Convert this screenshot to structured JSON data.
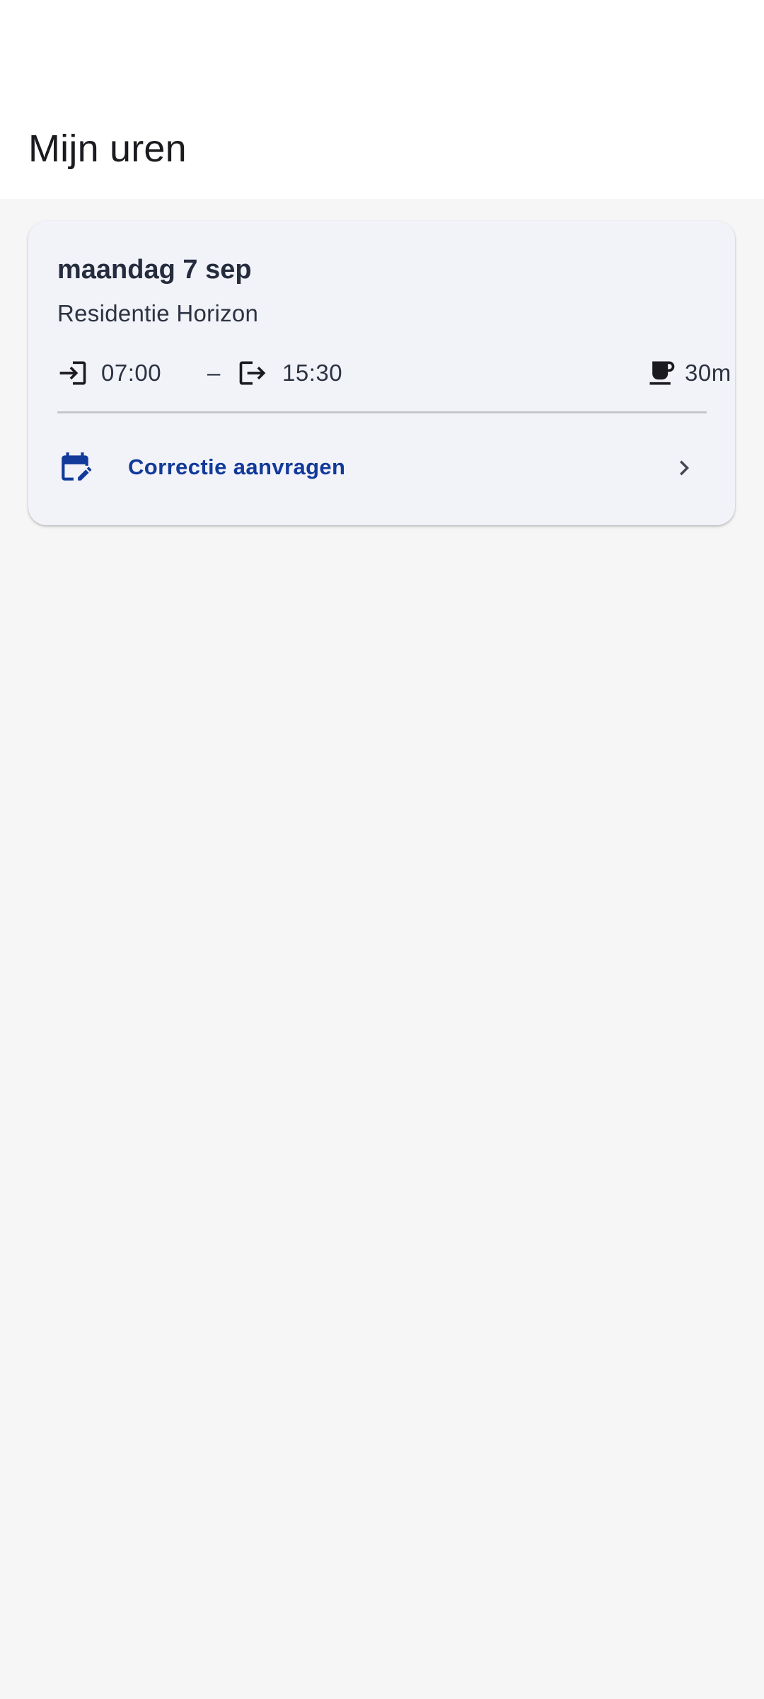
{
  "header": {
    "title": "Mijn uren"
  },
  "shift": {
    "day": "maandag 7 sep",
    "location": "Residentie Horizon",
    "start_time": "07:00",
    "separator": "–",
    "end_time": "15:30",
    "break_duration": "30m",
    "icons": {
      "clock_in": "login-icon",
      "clock_out": "logout-icon",
      "break": "coffee-cup-icon",
      "correction": "calendar-edit-icon",
      "chevron": "chevron-right-icon"
    },
    "action": {
      "label": "Correctie aanvragen"
    }
  },
  "colors": {
    "accent": "#113a9a",
    "card_background": "#f2f2f9",
    "page_background": "#f6f6f7",
    "text_primary": "#242c3d"
  }
}
